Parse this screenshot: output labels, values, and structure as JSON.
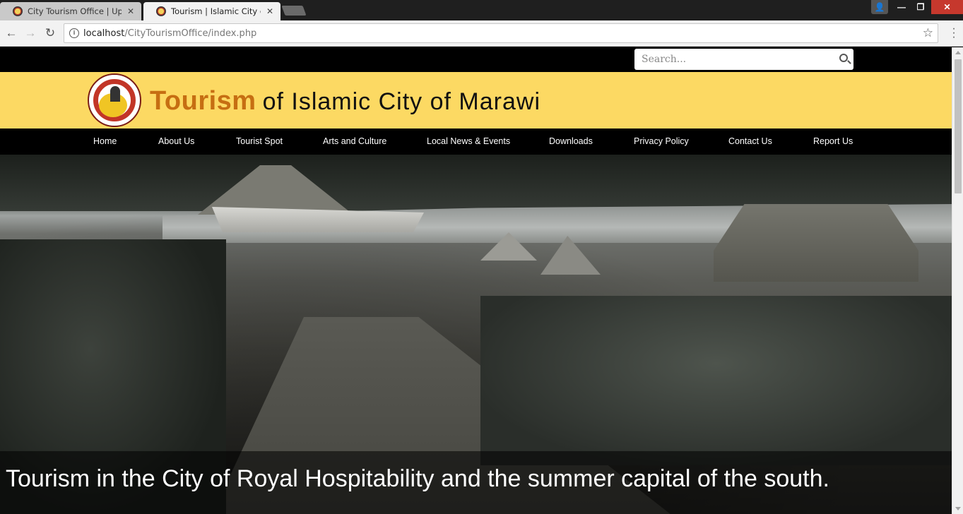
{
  "browser": {
    "tabs": [
      {
        "title": "City Tourism Office | Upd",
        "active": false
      },
      {
        "title": "Tourism | Islamic City of M",
        "active": true
      }
    ],
    "url": {
      "host": "localhost",
      "path": "/CityTourismOffice/index.php"
    }
  },
  "search": {
    "placeholder": "Search..."
  },
  "header": {
    "brand_accent": "Tourism",
    "brand_rest": "of Islamic City of Marawi"
  },
  "nav": {
    "items": [
      {
        "label": "Home"
      },
      {
        "label": "About Us"
      },
      {
        "label": "Tourist Spot"
      },
      {
        "label": "Arts and Culture"
      },
      {
        "label": "Local News & Events"
      },
      {
        "label": "Downloads"
      },
      {
        "label": "Privacy Policy"
      },
      {
        "label": "Contact Us"
      },
      {
        "label": "Report Us"
      }
    ]
  },
  "hero": {
    "caption": "Tourism in the City of Royal Hospitability and the summer capital of the south."
  },
  "colors": {
    "header_bg": "#fcd963",
    "brand_accent": "#c66e12",
    "nav_bg": "#000000"
  }
}
